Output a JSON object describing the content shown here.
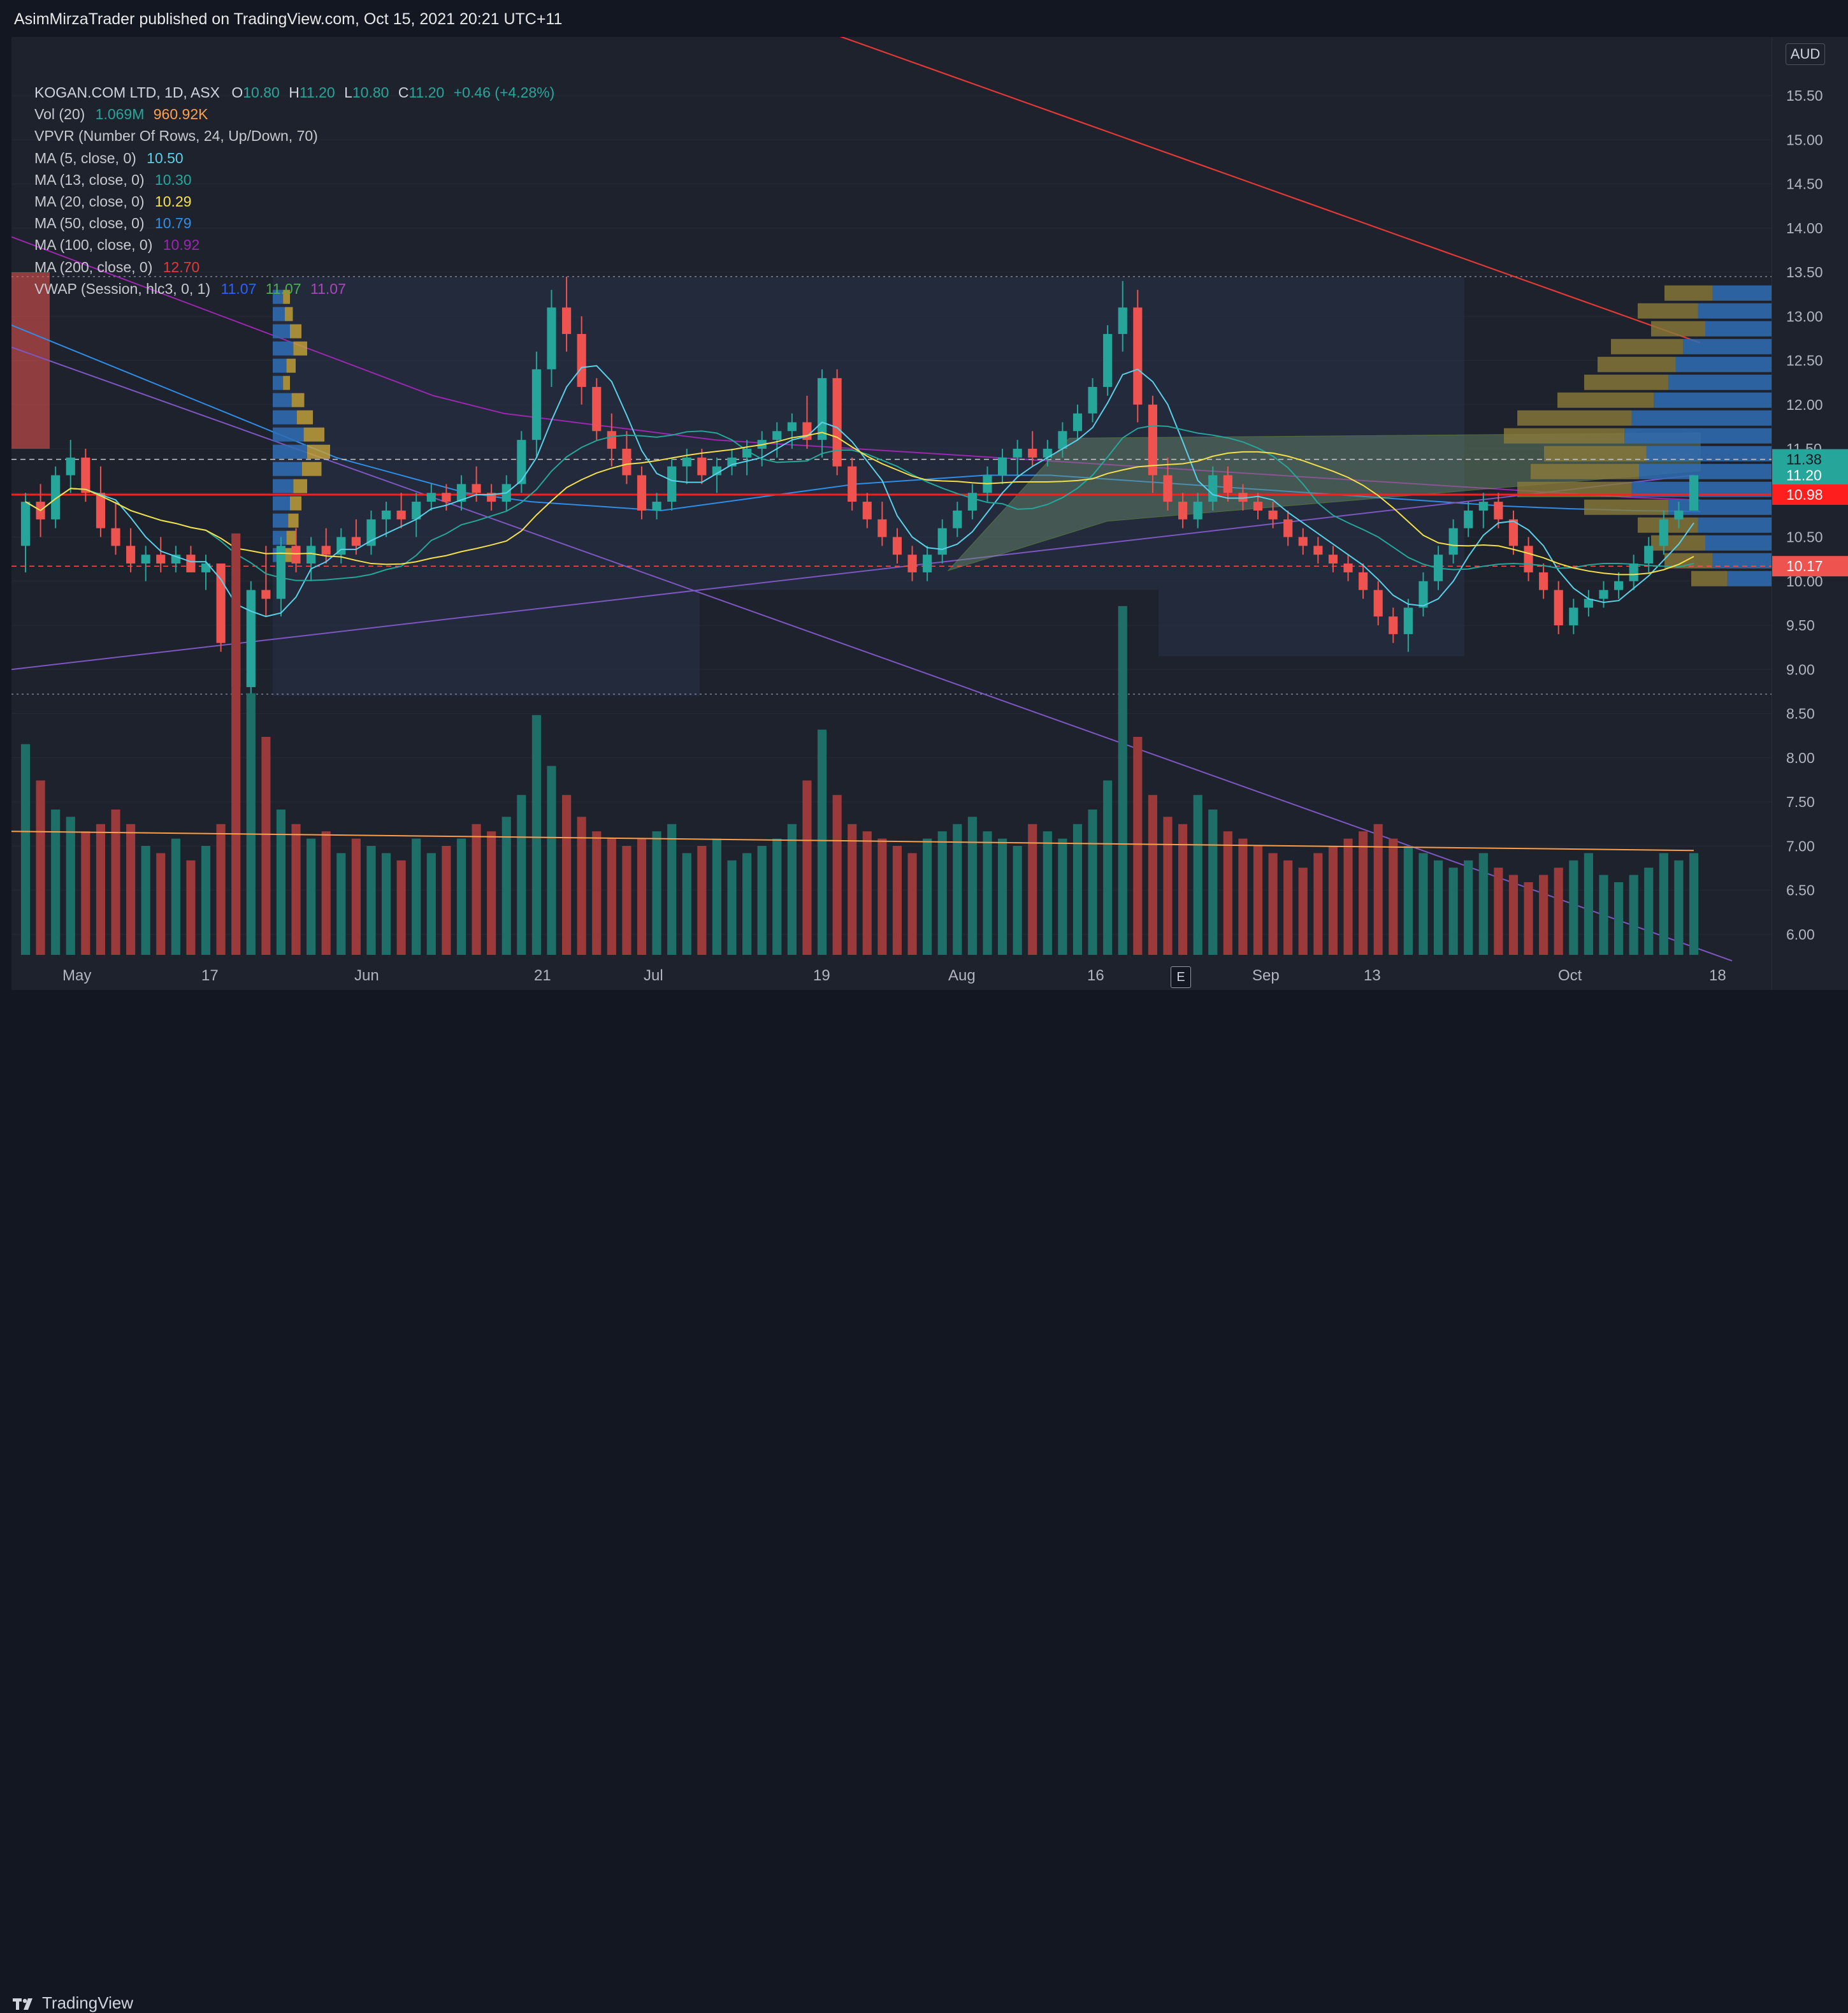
{
  "header": {
    "publish_line": "AsimMirzaTrader published on TradingView.com, Oct 15, 2021 20:21 UTC+11"
  },
  "legend": {
    "symbol_title": "KOGAN.COM LTD, 1D, ASX",
    "ohlc": {
      "o_label": "O",
      "o": "10.80",
      "h_label": "H",
      "h": "11.20",
      "l_label": "L",
      "l": "10.80",
      "c_label": "C",
      "c": "11.20",
      "change": "+0.46 (+4.28%)"
    },
    "vol": {
      "label": "Vol (20)",
      "v1": "1.069M",
      "v2": "960.92K"
    },
    "vpvr": {
      "label": "VPVR (Number Of Rows, 24, Up/Down, 70)"
    },
    "ma5": {
      "label": "MA (5, close, 0)",
      "value": "10.50"
    },
    "ma13": {
      "label": "MA (13, close, 0)",
      "value": "10.30"
    },
    "ma20": {
      "label": "MA (20, close, 0)",
      "value": "10.29"
    },
    "ma50": {
      "label": "MA (50, close, 0)",
      "value": "10.79"
    },
    "ma100": {
      "label": "MA (100, close, 0)",
      "value": "10.92"
    },
    "ma200": {
      "label": "MA (200, close, 0)",
      "value": "12.70"
    },
    "vwap": {
      "label": "VWAP (Session, hlc3, 0, 1)",
      "v1": "11.07",
      "v2": "11.07",
      "v3": "11.07"
    }
  },
  "currency": "AUD",
  "e_marker": "E",
  "brand": "TradingView",
  "colors": {
    "up": "#26a69a",
    "down": "#ef5350",
    "ma5": "#5ad1e9",
    "ma13": "#26a69a",
    "ma20": "#f5e04a",
    "ma50": "#2f8ee8",
    "ma100": "#9c27b0",
    "ma200": "#e53935",
    "vwap1": "#2962ff",
    "vwap2": "#4caf50",
    "vwap3": "#ab47bc",
    "volume_ma": "#ff9f4a",
    "trendline": "#7e57c2",
    "support_line": "#ff1e1e",
    "last_price": "#26a69a"
  },
  "price_axis": {
    "ticks": [
      "15.50",
      "15.00",
      "14.50",
      "14.00",
      "13.50",
      "13.00",
      "12.50",
      "12.00",
      "11.50",
      "11.00",
      "10.50",
      "10.00",
      "9.50",
      "9.00",
      "8.50",
      "8.00",
      "7.50",
      "7.00",
      "6.50",
      "6.00"
    ],
    "labels": [
      {
        "text": "11.38",
        "value": 11.38,
        "color": "#26a69a",
        "text_color": "#131722"
      },
      {
        "text": "11.20",
        "value": 11.2,
        "color": "#26a69a",
        "text_color": "#ffffff"
      },
      {
        "text": "10.98",
        "value": 10.98,
        "color": "#ff1e1e",
        "text_color": "#ffffff"
      },
      {
        "text": "10.17",
        "value": 10.17,
        "color": "#ef5350",
        "text_color": "#ffffff"
      }
    ]
  },
  "time_axis": {
    "ticks": [
      "May",
      "17",
      "Jun",
      "21",
      "Jul",
      "19",
      "Aug",
      "16",
      "Sep",
      "13",
      "Oct",
      "18"
    ]
  },
  "chart_data": {
    "type": "candlestick",
    "title": "KOGAN.COM LTD, 1D, ASX",
    "y_range_price": [
      8.45,
      15.9
    ],
    "horizontal_levels": [
      {
        "name": "support",
        "value": 10.98
      },
      {
        "name": "dashed-resistance",
        "value": 11.38
      },
      {
        "name": "dashed-support",
        "value": 10.17
      },
      {
        "name": "range-top",
        "value": 13.45
      },
      {
        "name": "range-bottom",
        "value": 8.7
      }
    ],
    "candles_ohlc": [
      [
        10.4,
        11.0,
        10.1,
        10.9
      ],
      [
        10.9,
        11.1,
        10.5,
        10.7
      ],
      [
        10.7,
        11.3,
        10.6,
        11.2
      ],
      [
        11.2,
        11.6,
        11.0,
        11.4
      ],
      [
        11.4,
        11.5,
        10.9,
        11.0
      ],
      [
        11.0,
        11.3,
        10.5,
        10.6
      ],
      [
        10.6,
        10.9,
        10.3,
        10.4
      ],
      [
        10.4,
        10.6,
        10.1,
        10.2
      ],
      [
        10.2,
        10.4,
        10.0,
        10.3
      ],
      [
        10.3,
        10.5,
        10.1,
        10.2
      ],
      [
        10.2,
        10.4,
        10.1,
        10.3
      ],
      [
        10.3,
        10.4,
        10.1,
        10.1
      ],
      [
        10.1,
        10.3,
        9.9,
        10.2
      ],
      [
        10.2,
        10.2,
        9.2,
        9.3
      ],
      [
        9.3,
        9.7,
        8.7,
        8.8
      ],
      [
        8.8,
        10.0,
        8.7,
        9.9
      ],
      [
        9.9,
        10.4,
        9.6,
        9.8
      ],
      [
        9.8,
        10.5,
        9.6,
        10.4
      ],
      [
        10.4,
        10.6,
        10.1,
        10.2
      ],
      [
        10.2,
        10.5,
        10.0,
        10.4
      ],
      [
        10.4,
        10.6,
        10.2,
        10.3
      ],
      [
        10.3,
        10.6,
        10.2,
        10.5
      ],
      [
        10.5,
        10.7,
        10.3,
        10.4
      ],
      [
        10.4,
        10.8,
        10.3,
        10.7
      ],
      [
        10.7,
        10.9,
        10.5,
        10.8
      ],
      [
        10.8,
        11.0,
        10.6,
        10.7
      ],
      [
        10.7,
        11.0,
        10.5,
        10.9
      ],
      [
        10.9,
        11.1,
        10.8,
        11.0
      ],
      [
        11.0,
        11.1,
        10.8,
        10.9
      ],
      [
        10.9,
        11.2,
        10.8,
        11.1
      ],
      [
        11.1,
        11.3,
        10.9,
        11.0
      ],
      [
        11.0,
        11.1,
        10.8,
        10.9
      ],
      [
        10.9,
        11.2,
        10.8,
        11.1
      ],
      [
        11.1,
        11.7,
        11.0,
        11.6
      ],
      [
        11.6,
        12.6,
        11.4,
        12.4
      ],
      [
        12.4,
        13.3,
        12.2,
        13.1
      ],
      [
        13.1,
        13.45,
        12.6,
        12.8
      ],
      [
        12.8,
        13.0,
        12.0,
        12.2
      ],
      [
        12.2,
        12.3,
        11.6,
        11.7
      ],
      [
        11.7,
        11.9,
        11.3,
        11.5
      ],
      [
        11.5,
        11.7,
        11.1,
        11.2
      ],
      [
        11.2,
        11.3,
        10.7,
        10.8
      ],
      [
        10.8,
        11.0,
        10.7,
        10.9
      ],
      [
        10.9,
        11.4,
        10.8,
        11.3
      ],
      [
        11.3,
        11.5,
        11.1,
        11.4
      ],
      [
        11.4,
        11.5,
        11.1,
        11.2
      ],
      [
        11.2,
        11.4,
        11.0,
        11.3
      ],
      [
        11.3,
        11.5,
        11.2,
        11.4
      ],
      [
        11.4,
        11.6,
        11.2,
        11.5
      ],
      [
        11.5,
        11.7,
        11.3,
        11.6
      ],
      [
        11.6,
        11.8,
        11.4,
        11.7
      ],
      [
        11.7,
        11.9,
        11.5,
        11.8
      ],
      [
        11.8,
        12.1,
        11.5,
        11.6
      ],
      [
        11.6,
        12.4,
        11.4,
        12.3
      ],
      [
        12.3,
        12.4,
        11.2,
        11.3
      ],
      [
        11.3,
        11.4,
        10.8,
        10.9
      ],
      [
        10.9,
        11.0,
        10.6,
        10.7
      ],
      [
        10.7,
        10.9,
        10.4,
        10.5
      ],
      [
        10.5,
        10.6,
        10.2,
        10.3
      ],
      [
        10.3,
        10.4,
        10.0,
        10.1
      ],
      [
        10.1,
        10.4,
        10.0,
        10.3
      ],
      [
        10.3,
        10.7,
        10.2,
        10.6
      ],
      [
        10.6,
        10.9,
        10.5,
        10.8
      ],
      [
        10.8,
        11.1,
        10.7,
        11.0
      ],
      [
        11.0,
        11.3,
        10.9,
        11.2
      ],
      [
        11.2,
        11.5,
        11.1,
        11.4
      ],
      [
        11.4,
        11.6,
        11.2,
        11.5
      ],
      [
        11.5,
        11.7,
        11.3,
        11.4
      ],
      [
        11.4,
        11.6,
        11.3,
        11.5
      ],
      [
        11.5,
        11.8,
        11.4,
        11.7
      ],
      [
        11.7,
        12.0,
        11.6,
        11.9
      ],
      [
        11.9,
        12.3,
        11.8,
        12.2
      ],
      [
        12.2,
        12.9,
        12.1,
        12.8
      ],
      [
        12.8,
        13.4,
        12.6,
        13.1
      ],
      [
        13.1,
        13.3,
        11.8,
        12.0
      ],
      [
        12.0,
        12.1,
        11.0,
        11.2
      ],
      [
        11.2,
        11.4,
        10.8,
        10.9
      ],
      [
        10.9,
        11.0,
        10.6,
        10.7
      ],
      [
        10.7,
        11.0,
        10.6,
        10.9
      ],
      [
        10.9,
        11.3,
        10.8,
        11.2
      ],
      [
        11.2,
        11.3,
        10.9,
        11.0
      ],
      [
        11.0,
        11.1,
        10.8,
        10.9
      ],
      [
        10.9,
        11.0,
        10.7,
        10.8
      ],
      [
        10.8,
        10.9,
        10.6,
        10.7
      ],
      [
        10.7,
        10.8,
        10.4,
        10.5
      ],
      [
        10.5,
        10.6,
        10.3,
        10.4
      ],
      [
        10.4,
        10.5,
        10.2,
        10.3
      ],
      [
        10.3,
        10.4,
        10.1,
        10.2
      ],
      [
        10.2,
        10.3,
        10.0,
        10.1
      ],
      [
        10.1,
        10.2,
        9.8,
        9.9
      ],
      [
        9.9,
        10.0,
        9.5,
        9.6
      ],
      [
        9.6,
        9.7,
        9.3,
        9.4
      ],
      [
        9.4,
        9.8,
        9.2,
        9.7
      ],
      [
        9.7,
        10.1,
        9.6,
        10.0
      ],
      [
        10.0,
        10.4,
        9.9,
        10.3
      ],
      [
        10.3,
        10.7,
        10.2,
        10.6
      ],
      [
        10.6,
        10.9,
        10.5,
        10.8
      ],
      [
        10.8,
        11.0,
        10.6,
        10.9
      ],
      [
        10.9,
        11.0,
        10.6,
        10.7
      ],
      [
        10.7,
        10.8,
        10.3,
        10.4
      ],
      [
        10.4,
        10.5,
        10.0,
        10.1
      ],
      [
        10.1,
        10.2,
        9.8,
        9.9
      ],
      [
        9.9,
        10.0,
        9.4,
        9.5
      ],
      [
        9.5,
        9.8,
        9.4,
        9.7
      ],
      [
        9.7,
        9.9,
        9.6,
        9.8
      ],
      [
        9.8,
        10.0,
        9.7,
        9.9
      ],
      [
        9.9,
        10.1,
        9.8,
        10.0
      ],
      [
        10.0,
        10.3,
        9.9,
        10.2
      ],
      [
        10.2,
        10.5,
        10.1,
        10.4
      ],
      [
        10.4,
        10.8,
        10.3,
        10.7
      ],
      [
        10.7,
        10.9,
        10.6,
        10.8
      ],
      [
        10.8,
        11.2,
        10.8,
        11.2
      ]
    ],
    "volume_series": [
      1.45,
      1.2,
      1.0,
      0.95,
      0.85,
      0.9,
      1.0,
      0.9,
      0.75,
      0.7,
      0.8,
      0.65,
      0.75,
      0.9,
      2.9,
      1.8,
      1.5,
      1.0,
      0.9,
      0.8,
      0.85,
      0.7,
      0.8,
      0.75,
      0.7,
      0.65,
      0.8,
      0.7,
      0.75,
      0.8,
      0.9,
      0.85,
      0.95,
      1.1,
      1.65,
      1.3,
      1.1,
      0.95,
      0.85,
      0.8,
      0.75,
      0.8,
      0.85,
      0.9,
      0.7,
      0.75,
      0.8,
      0.65,
      0.7,
      0.75,
      0.8,
      0.9,
      1.2,
      1.55,
      1.1,
      0.9,
      0.85,
      0.8,
      0.75,
      0.7,
      0.8,
      0.85,
      0.9,
      0.95,
      0.85,
      0.8,
      0.75,
      0.9,
      0.85,
      0.8,
      0.9,
      1.0,
      1.2,
      2.4,
      1.5,
      1.1,
      0.95,
      0.9,
      1.1,
      1.0,
      0.85,
      0.8,
      0.75,
      0.7,
      0.65,
      0.6,
      0.7,
      0.75,
      0.8,
      0.85,
      0.9,
      0.8,
      0.75,
      0.7,
      0.65,
      0.6,
      0.65,
      0.7,
      0.6,
      0.55,
      0.5,
      0.55,
      0.6,
      0.65,
      0.7,
      0.55,
      0.5,
      0.55,
      0.6,
      0.7,
      0.65,
      0.7
    ],
    "volume_ma_level": 0.85,
    "ma200_series": [
      17.2,
      17.1,
      17.0,
      16.9,
      16.8,
      16.7,
      16.6,
      16.5,
      16.4,
      16.3,
      16.2,
      16.1,
      16.0,
      15.9,
      15.8,
      15.7,
      15.6,
      15.5,
      15.4,
      15.3,
      15.2,
      15.1,
      15.0,
      14.9,
      14.8,
      14.7,
      14.6,
      14.5,
      14.4,
      14.3,
      14.2,
      14.1,
      14.0,
      13.9,
      13.8,
      13.7,
      13.6,
      13.5,
      13.4,
      13.3,
      13.2,
      13.1,
      13.0,
      12.9,
      12.8,
      12.7
    ],
    "ma100_series": [
      13.9,
      13.6,
      13.3,
      13.0,
      12.7,
      12.4,
      12.1,
      11.9,
      11.8,
      11.7,
      11.6,
      11.55,
      11.5,
      11.45,
      11.4,
      11.35,
      11.3,
      11.25,
      11.2,
      11.15,
      11.1,
      11.05,
      11.0,
      10.95,
      10.92
    ],
    "ma50_series": [
      12.9,
      12.6,
      12.3,
      12.0,
      11.7,
      11.4,
      11.2,
      11.0,
      10.9,
      10.85,
      10.8,
      10.9,
      11.0,
      11.1,
      11.15,
      11.2,
      11.2,
      11.15,
      11.1,
      11.05,
      11.0,
      10.95,
      10.9,
      10.85,
      10.82,
      10.8,
      10.79
    ],
    "vpvr_left": [
      0.3,
      0.35,
      0.5,
      0.6,
      0.4,
      0.3,
      0.55,
      0.7,
      0.9,
      1.0,
      0.85,
      0.6,
      0.5,
      0.45,
      0.4,
      0.35
    ],
    "vpvr_right": [
      0.4,
      0.5,
      0.45,
      0.6,
      0.65,
      0.7,
      0.8,
      0.95,
      1.0,
      0.85,
      0.9,
      0.95,
      0.7,
      0.5,
      0.45,
      0.4,
      0.3
    ]
  }
}
